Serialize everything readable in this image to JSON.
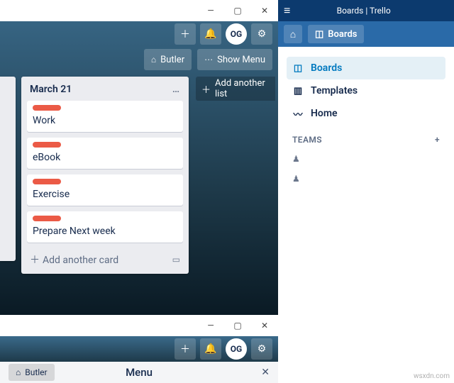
{
  "left": {
    "titlebar": {
      "min": "—",
      "max": "▢",
      "close": "✕"
    },
    "toolbar": {
      "plus": "＋",
      "bell": "🔔",
      "avatar": "OG",
      "gear": "⚙"
    },
    "boardbar": {
      "butler_icon": "⌂",
      "butler": "Butler",
      "showmenu_icon": "⋯",
      "showmenu": "Show Menu"
    },
    "list": {
      "title": "March 21",
      "menu": "…",
      "cards": [
        "Work",
        "eBook",
        "Exercise",
        "Prepare Next week"
      ],
      "add_card": "Add another card"
    },
    "add_list": "Add another list"
  },
  "bottom": {
    "toolbar": {
      "plus": "＋",
      "bell": "🔔",
      "avatar": "OG",
      "gear": "⚙"
    },
    "butler_icon": "⌂",
    "butler": "Butler",
    "menu_title": "Menu",
    "close": "✕"
  },
  "right": {
    "title": "Boards | Trello",
    "hamburger": "≡",
    "tabs": {
      "home_icon": "⌂",
      "boards_icon": "◫",
      "boards": "Boards"
    },
    "sidebar": [
      {
        "icon": "◫",
        "label": "Boards",
        "active": true
      },
      {
        "icon": "▥",
        "label": "Templates",
        "active": false
      },
      {
        "icon": "〰",
        "label": "Home",
        "active": false
      }
    ],
    "teams_header": "TEAMS",
    "teams_plus": "+",
    "teams": [
      {
        "icon": "♟"
      },
      {
        "icon": "♟"
      }
    ]
  },
  "watermark": "wsxdn.com"
}
